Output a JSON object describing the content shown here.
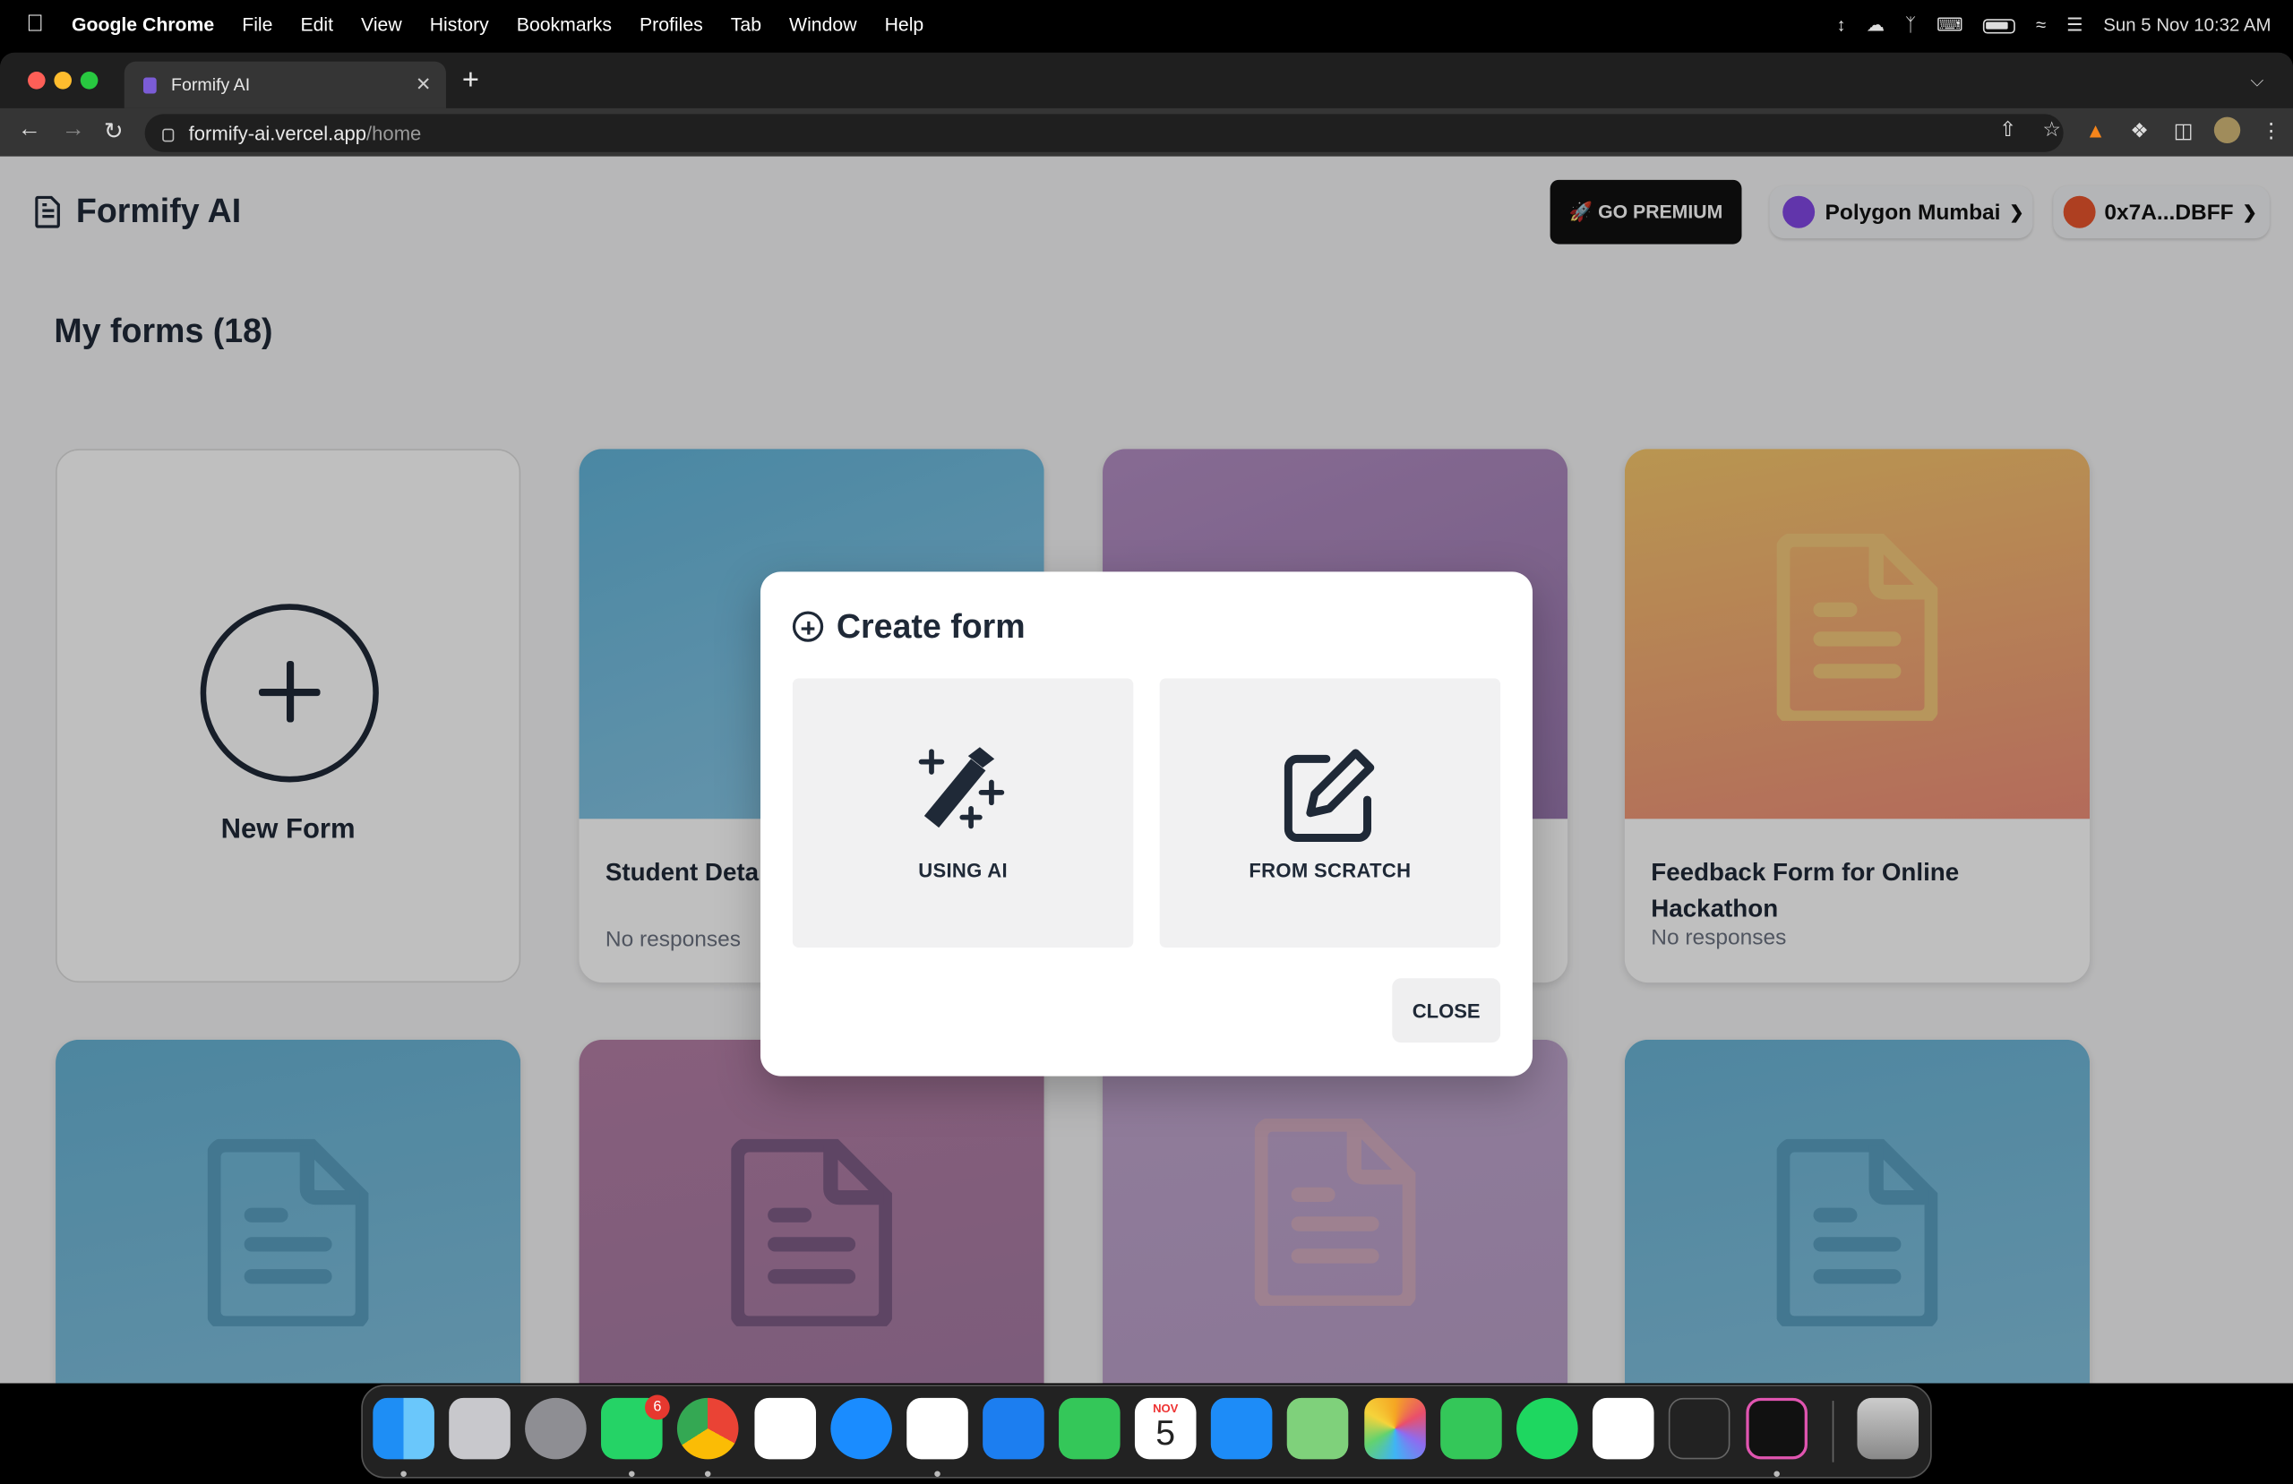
{
  "menubar": {
    "app": "Google Chrome",
    "items": [
      "File",
      "Edit",
      "View",
      "History",
      "Bookmarks",
      "Profiles",
      "Tab",
      "Window",
      "Help"
    ],
    "clock": "Sun 5 Nov  10:32 AM"
  },
  "browser": {
    "tab_title": "Formify AI",
    "url_host": "formify-ai.vercel.app",
    "url_path": "/home"
  },
  "header": {
    "app_title": "Formify AI",
    "premium_label": "🚀 GO PREMIUM",
    "network_label": "Polygon Mumbai",
    "account_label": "0x7A...DBFF"
  },
  "main": {
    "section_title": "My forms (18)",
    "new_form_label": "New Form",
    "cards": [
      {
        "title": "Student Deta",
        "subtitle": "No responses",
        "color_top": "#5fb3d9"
      },
      {
        "title": "",
        "subtitle": "",
        "color_top": "#9a79b0"
      },
      {
        "title": "Feedback Form for Online Hackathon",
        "subtitle": "No responses",
        "color_top": "#f29a7a"
      }
    ]
  },
  "modal": {
    "title": "Create form",
    "option_ai": "USING AI",
    "option_scratch": "FROM SCRATCH",
    "close_label": "CLOSE"
  },
  "dock": {
    "whatsapp_badge": "6",
    "calendar_month": "NOV",
    "calendar_day": "5"
  }
}
